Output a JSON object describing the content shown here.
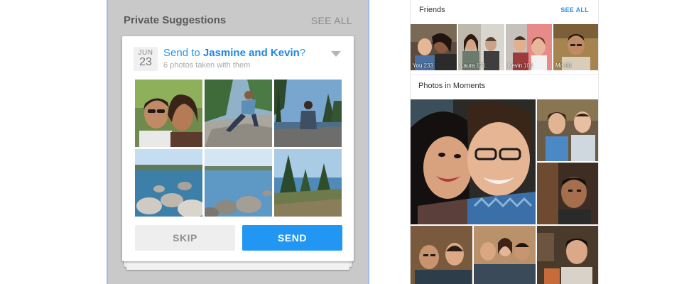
{
  "private_suggestions": {
    "title": "Private Suggestions",
    "see_all": "SEE ALL",
    "card": {
      "date_month": "JUN",
      "date_day": "23",
      "send_prefix": "Send to ",
      "send_names": "Jasmine and Kevin",
      "send_suffix": "?",
      "subtitle": "6 photos taken with them",
      "skip_label": "SKIP",
      "send_label": "SEND"
    }
  },
  "friends": {
    "title": "Friends",
    "see_all": "SEE ALL",
    "items": [
      {
        "name": "You",
        "count": "233"
      },
      {
        "name": "Laura",
        "count": "171"
      },
      {
        "name": "Kevin",
        "count": "102"
      },
      {
        "name": "Mo",
        "count": "98"
      }
    ]
  },
  "moments": {
    "title": "Photos in Moments"
  },
  "colors": {
    "accent": "#2196f3",
    "panel_gray": "#c9c9c9",
    "frame_blue": "#9dbde6"
  }
}
